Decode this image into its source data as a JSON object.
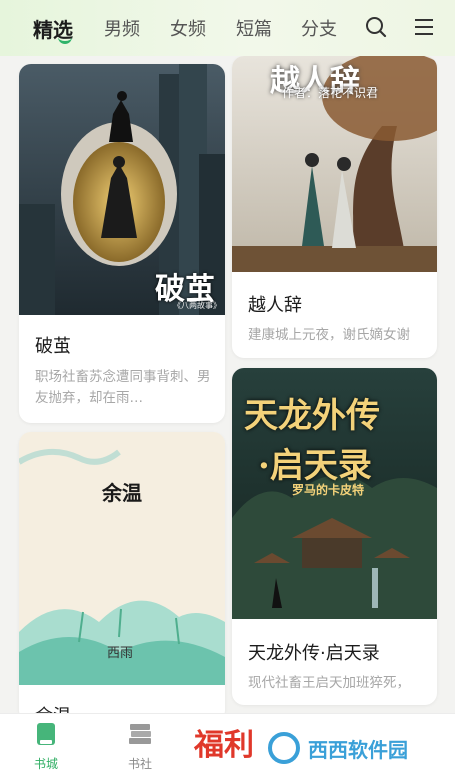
{
  "header": {
    "tabs": [
      {
        "label": "精选",
        "active": true
      },
      {
        "label": "男频"
      },
      {
        "label": "女频"
      },
      {
        "label": "短篇"
      },
      {
        "label": "分支"
      }
    ],
    "icons": [
      "search-icon",
      "menu-icon"
    ]
  },
  "books": [
    {
      "title": "破茧",
      "desc": "职场社畜苏念遭同事背刺、男友抛弃，却在雨…",
      "cover_text": "破茧",
      "cover_sub": "《八两故事》"
    },
    {
      "title": "越人辞",
      "desc": "建康城上元夜，谢氏嫡女谢",
      "cover_text": "越人辞",
      "cover_sub": "作者：落花不识君"
    },
    {
      "title": "余温",
      "cover_text": "余温",
      "cover_sub": "西雨"
    },
    {
      "title": "天龙外传·启天录",
      "desc": "现代社畜王启天加班猝死，",
      "cover_text_1": "天龙外传",
      "cover_text_2": "·启天录",
      "cover_sub": "罗马的卡皮特"
    }
  ],
  "bottom_nav": [
    {
      "label": "书城",
      "icon": "book-icon",
      "active": true
    },
    {
      "label": "书社",
      "icon": "books-stack-icon"
    },
    {
      "label": "福利",
      "icon": "welfare-badge-icon"
    }
  ],
  "watermark": "西西软件园",
  "colors": {
    "accent": "#2fae63",
    "header_bg": "#e9f6df",
    "page_bg": "#f3f3f1"
  }
}
